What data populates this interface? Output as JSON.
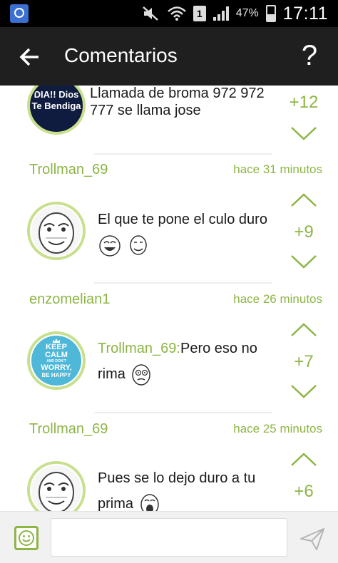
{
  "statusbar": {
    "sim_slot": "1",
    "battery": "47%",
    "time": "17:11",
    "icons": [
      "app-search-icon",
      "mute-icon",
      "wifi-icon",
      "sim-icon",
      "signal-icon",
      "battery-icon"
    ]
  },
  "header": {
    "title": "Comentarios",
    "back_icon": "arrow-back-icon",
    "help_label": "?"
  },
  "comments": [
    {
      "avatar_text": "DIA!! Dios Te Bendiga",
      "text": "Llamada de broma 972 972 777 se llama jose",
      "score": "+12"
    },
    {
      "username": "Trollman_69",
      "time": "hace 31 minutos",
      "avatar": "me-gusta-meme",
      "text": "El que te pone el culo duro",
      "memes": [
        "laughing-meme",
        "yao-ming-meme"
      ],
      "score": "+9"
    },
    {
      "username": "enzomelian1",
      "time": "hace 26 minutos",
      "avatar": "keep-calm",
      "avatar_text": [
        "KEEP",
        "CALM",
        "AND DON'T",
        "WORRY,",
        "BE HAPPY"
      ],
      "mention": "Trollman_69:",
      "text": "Pero eso no rima",
      "memes": [
        "fuuu-meme"
      ],
      "score": "+7"
    },
    {
      "username": "Trollman_69",
      "time": "hace 25 minutos",
      "avatar": "me-gusta-meme",
      "text": "Pues se lo dejo duro a tu prima",
      "memes": [
        "ohgod-meme"
      ],
      "score": "+6"
    }
  ],
  "composer": {
    "input_value": "",
    "input_placeholder": "",
    "emoji_icon": "smiley-icon",
    "send_icon": "send-icon"
  },
  "colors": {
    "accent": "#8db545",
    "appbar": "#1f1f1f",
    "statusbar": "#000000",
    "avatar_ring": "#c8e08e"
  }
}
